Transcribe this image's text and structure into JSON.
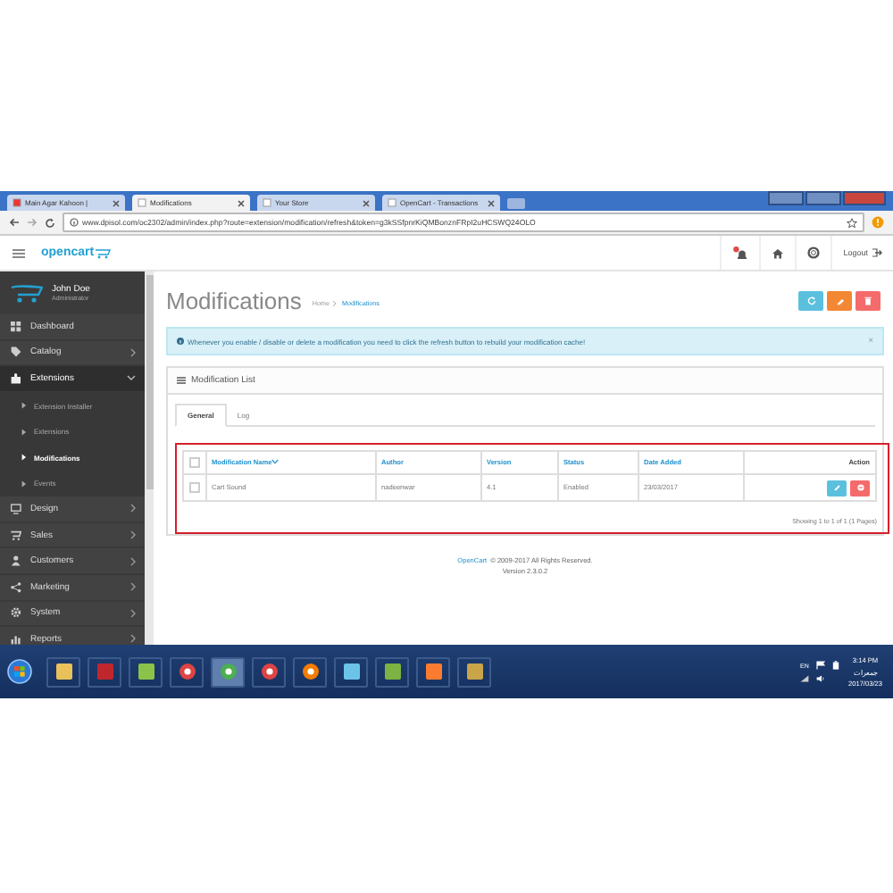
{
  "browser": {
    "tabs": [
      {
        "label": "Main Agar Kahoon |",
        "selected": false
      },
      {
        "label": "Modifications",
        "selected": true
      },
      {
        "label": "Your Store",
        "selected": false
      },
      {
        "label": "OpenCart - Transactions",
        "selected": false
      }
    ],
    "url": "www.dpisol.com/oc2302/admin/index.php?route=extension/modification/refresh&token=g3kSSfpnrKiQMBonznFRpI2uHCSWQ24OLO"
  },
  "header": {
    "logo": "opencart",
    "logout": "Logout"
  },
  "sidebar": {
    "user": {
      "name": "John Doe",
      "role": "Administrator"
    },
    "items": [
      {
        "label": "Dashboard",
        "kind": "link"
      },
      {
        "label": "Catalog",
        "kind": "menu",
        "expanded": false
      },
      {
        "label": "Extensions",
        "kind": "menu",
        "expanded": true,
        "children": [
          {
            "label": "Extension Installer",
            "selected": false
          },
          {
            "label": "Extensions",
            "selected": false
          },
          {
            "label": "Modifications",
            "selected": true
          },
          {
            "label": "Events",
            "selected": false
          }
        ]
      },
      {
        "label": "Design",
        "kind": "menu",
        "expanded": false
      },
      {
        "label": "Sales",
        "kind": "menu",
        "expanded": false
      },
      {
        "label": "Customers",
        "kind": "menu",
        "expanded": false
      },
      {
        "label": "Marketing",
        "kind": "menu",
        "expanded": false
      },
      {
        "label": "System",
        "kind": "menu",
        "expanded": false
      },
      {
        "label": "Reports",
        "kind": "menu",
        "expanded": false
      }
    ]
  },
  "page": {
    "title": "Modifications",
    "breadcrumb": [
      "Home",
      "Modifications"
    ],
    "alert": "Whenever you enable / disable or delete a modification you need to click the refresh button to rebuild your modification cache!",
    "alert_close": "×",
    "panel": {
      "title": "Modification List",
      "tabs": [
        {
          "label": "General",
          "selected": true
        },
        {
          "label": "Log",
          "selected": false
        }
      ],
      "table": {
        "columns": [
          {
            "label": "Modification Name",
            "sorted": true
          },
          {
            "label": "Author",
            "sorted": false
          },
          {
            "label": "Version",
            "sorted": false
          },
          {
            "label": "Status",
            "sorted": false
          },
          {
            "label": "Date Added",
            "sorted": false
          },
          {
            "label": "Action",
            "sorted": false
          }
        ],
        "all_checked": false,
        "rows": [
          {
            "checked": false,
            "cells": [
              "Cart Sound",
              "nadeenwar",
              "4.1",
              "Enabled",
              "23/03/2017"
            ]
          }
        ]
      },
      "pagination": "Showing 1 to 1 of 1 (1 Pages)"
    },
    "footer": {
      "link": "OpenCart",
      "text": "© 2009-2017 All Rights Reserved.",
      "version": "Version 2.3.0.2"
    }
  },
  "taskbar": {
    "language": "EN",
    "time": "3:14 PM",
    "day": "جمعرات",
    "date": "2017/03/23"
  }
}
